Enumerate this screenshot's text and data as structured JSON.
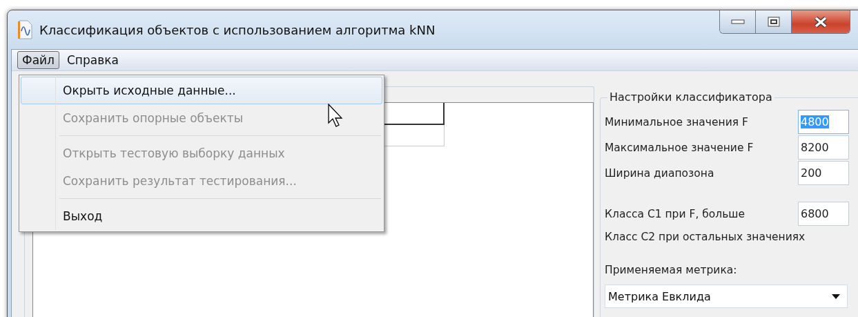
{
  "window": {
    "title": "Классификация объектов с использованием алгоритма kNN"
  },
  "menubar": [
    {
      "label": "Файл",
      "selected": true
    },
    {
      "label": "Справка",
      "selected": false
    }
  ],
  "file_menu": [
    {
      "kind": "item",
      "label": "Окрыть исходные данные...",
      "disabled": false,
      "selected": true
    },
    {
      "kind": "item",
      "label": "Сохранить опорные объекты",
      "disabled": true,
      "selected": false
    },
    {
      "kind": "separator"
    },
    {
      "kind": "item",
      "label": "Открыть тестовую выборку данных",
      "disabled": true,
      "selected": false
    },
    {
      "kind": "item",
      "label": "Сохранить результат тестирования...",
      "disabled": true,
      "selected": false
    },
    {
      "kind": "separator"
    },
    {
      "kind": "item",
      "label": "Выход",
      "disabled": false,
      "selected": false
    }
  ],
  "settings": {
    "title": "Настройки классификатора",
    "fields": [
      {
        "label": "Минимальное значения F",
        "value": "4800",
        "selected": true
      },
      {
        "label": "Максимальное значение F",
        "value": "8200",
        "selected": false
      },
      {
        "label": "Ширина диапозона",
        "value": "200",
        "selected": false
      },
      {
        "kind": "gap"
      },
      {
        "label": "Класса C1 при F, больше",
        "value": "6800",
        "selected": false
      }
    ],
    "note": "Класс C2 при остальных значениях",
    "metric_label": "Применяемая метрика:",
    "metric": "Метрика Евклида"
  }
}
